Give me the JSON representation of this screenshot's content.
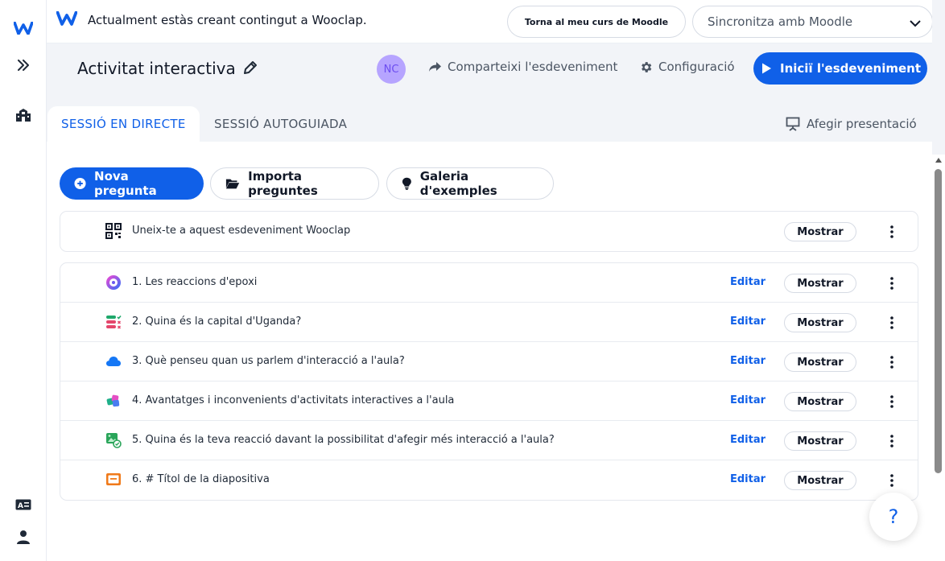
{
  "banner": {
    "text": "Actualment estàs creant contingut a Wooclap.",
    "moodle_button": "Torna al meu curs de Moodle",
    "sync_select": "Sincronitza amb Moodle"
  },
  "header": {
    "title": "Activitat interactiva",
    "avatar_initials": "NC",
    "share": "Comparteixi l'esdeveniment",
    "settings": "Configuració",
    "start": "Iniciï l'esdeveniment"
  },
  "tabs": {
    "live": "SESSIÓ EN DIRECTE",
    "selfpaced": "SESSIÓ AUTOGUIADA",
    "add_presentation": "Afegir presentació"
  },
  "toolbar": {
    "new_question": "Nova pregunta",
    "import": "Importa preguntes",
    "gallery": "Galeria d'exemples"
  },
  "join_row": {
    "label": "Uneix-te a aquest esdeveniment Wooclap",
    "show": "Mostrar"
  },
  "questions": [
    {
      "label": "1.  Les reaccions d'epoxi",
      "edit": "Editar",
      "show": "Mostrar",
      "icon": "poll-ring-icon"
    },
    {
      "label": "2.  Quina és la capital d'Uganda?",
      "edit": "Editar",
      "show": "Mostrar",
      "icon": "mcq-icon"
    },
    {
      "label": "3.  Què penseu quan us parlem d'interacció a l'aula?",
      "edit": "Editar",
      "show": "Mostrar",
      "icon": "wordcloud-icon"
    },
    {
      "label": "4.  Avantatges i inconvenients d'activitats interactives a l'aula",
      "edit": "Editar",
      "show": "Mostrar",
      "icon": "brainstorm-icon"
    },
    {
      "label": "5.  Quina és la teva reacció davant la possibilitat d'afegir més interacció a l'aula?",
      "edit": "Editar",
      "show": "Mostrar",
      "icon": "image-reaction-icon"
    },
    {
      "label": "6.  # Títol de la diapositiva",
      "edit": "Editar",
      "show": "Mostrar",
      "icon": "slide-icon"
    }
  ],
  "help": "?",
  "colors": {
    "accent": "#1060e8",
    "bg_band": "#f2f4f8",
    "avatar": "#b6a4ff"
  }
}
